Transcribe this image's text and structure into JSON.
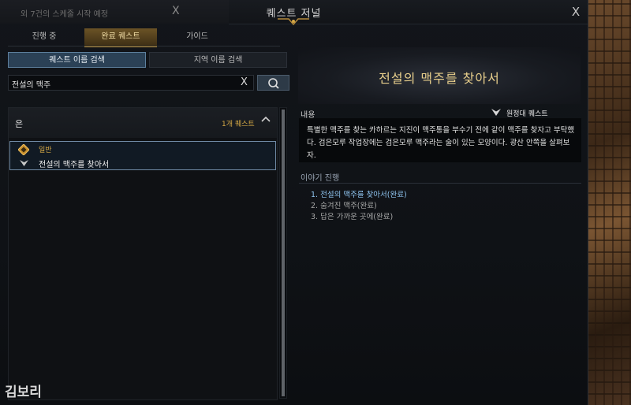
{
  "background": {
    "notice_text": "외 7건의 스케줄 시작 예정",
    "notice_close": "X"
  },
  "window": {
    "title": "퀘스트 저널",
    "close_glyph": "X"
  },
  "tabs": [
    {
      "label": "진행 중",
      "active": false
    },
    {
      "label": "완료 퀘스트",
      "active": true
    },
    {
      "label": "가이드",
      "active": false
    }
  ],
  "search_modes": [
    {
      "label": "퀘스트 이름 검색",
      "active": true
    },
    {
      "label": "지역 이름 검색",
      "active": false
    }
  ],
  "search": {
    "value": "전설의 맥주",
    "clear_glyph": "X"
  },
  "quest_list": {
    "group_name": "은",
    "group_count": "1개 퀘스트",
    "group_arrow": "^",
    "items": [
      {
        "category": "일반",
        "name": "전설의 맥주를 찾아서"
      }
    ]
  },
  "detail": {
    "title": "전설의 맥주를 찾아서",
    "content_label": "내용",
    "badge_label": "원정대 퀘스트",
    "description": "특별한 맥주를 찾는 카하르는 지진이 맥주통을 부수기 전에 같이 맥주를 찾자고 부탁했다. 검은모루 작업장에는 검은모루 맥주라는 술이 있는 모양이다. 광산 안쪽을 살펴보자.",
    "story_label": "이야기 진행",
    "steps": [
      "1. 전설의 맥주를 찾아서(완료)",
      "2. 숨겨진 맥주(완료)",
      "3. 답은 가까운 곳에(완료)"
    ]
  },
  "watermark": "김보리",
  "colors": {
    "accent_gold": "#d5a845",
    "title_gold": "#e8cf8c",
    "active_step_blue": "#8fc4f0",
    "selection_border": "#6f8aa5"
  }
}
